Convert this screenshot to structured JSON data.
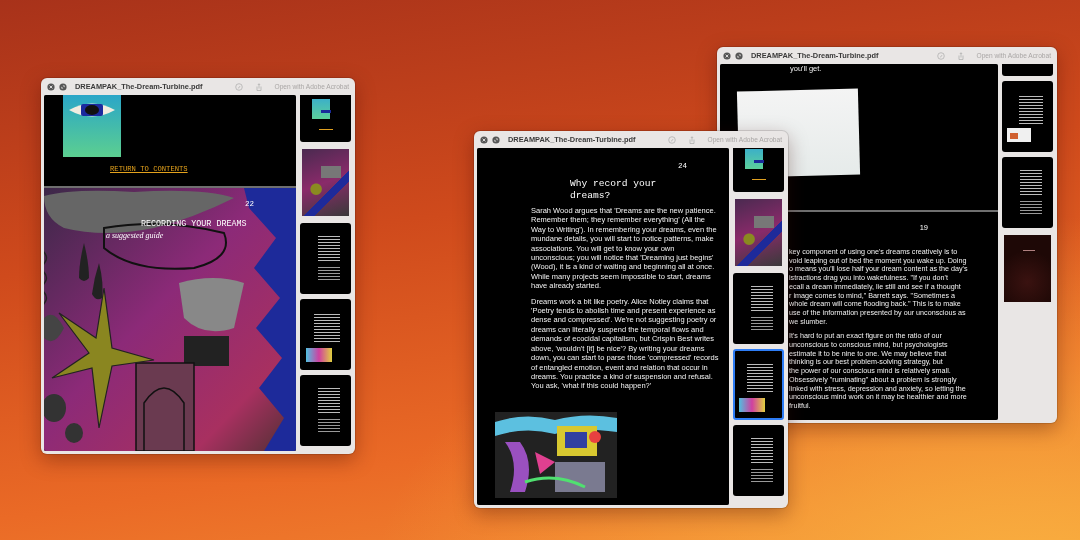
{
  "windows": [
    {
      "title": "DREAMPAK_The-Dream-Turbine.pdf",
      "open_button": "Open with Adobe Acrobat",
      "pages": [
        {
          "kind": "cover",
          "link": "RETURN TO CONTENTS"
        },
        {
          "kind": "art",
          "page_number": "22",
          "title": "RECORDING YOUR DREAMS",
          "subtitle": "a suggested guide"
        }
      ],
      "thumbnails": [
        {
          "kind": "cover",
          "selected": false
        },
        {
          "kind": "art",
          "selected": false
        },
        {
          "kind": "text",
          "selected": false
        },
        {
          "kind": "text-art",
          "selected": false
        },
        {
          "kind": "text",
          "selected": false
        }
      ]
    },
    {
      "title": "DREAMPAK_The-Dream-Turbine.pdf",
      "open_button": "Open with Adobe Acrobat",
      "pages": [
        {
          "kind": "text-art",
          "page_number": "24",
          "heading": "Why record your dreams?",
          "paragraphs": [
            "Sarah Wood argues that 'Dreams are the new patience. Remember them; they remember everything' (All the Way to Writing'). In remembering your dreams, even the mundane details, you will start to notice patterns, make associations. You will get to know your own unconscious; you will notice that 'Dreaming just begins' (Wood), it is a kind of waiting and beginning all at once. While many projects seem impossible to start, dreams have already started.",
            "Dreams work a bit like poetry. Alice Notley claims that 'Poetry tends to abolish time and present experience as dense and compressed'. We're not suggesting poetry or dreams can literally suspend the temporal flows and demands of ecocidal capitalism, but Crispin Best writes above, 'wouldn't [it] be nice'? By writing your dreams down, you can start to parse those 'compressed' records of entangled emotion, event and relation that occur in dreams. You practice a kind of suspension and refusal. You ask, 'what if this could happen?'"
          ]
        }
      ],
      "thumbnails": [
        {
          "kind": "cover",
          "selected": false
        },
        {
          "kind": "art",
          "selected": false
        },
        {
          "kind": "text",
          "selected": false
        },
        {
          "kind": "text-art",
          "selected": true
        },
        {
          "kind": "text",
          "selected": false
        }
      ]
    },
    {
      "title": "DREAMPAK_The-Dream-Turbine.pdf",
      "open_button": "Open with Adobe Acrobat",
      "pages": [
        {
          "kind": "photo",
          "text": "you'll get."
        },
        {
          "kind": "lines",
          "page_number": "19",
          "paragraphs": [
            [
              "key component of using one's dreams creatively is to",
              "void leaping out of bed the moment you wake up. Doing",
              "o means you'll lose half your dream content as the day's",
              "istractions drag you into wakefulness. \"If you don't",
              "ecall a dream immediately, lie still and see if a thought",
              "r image comes to mind,\" Barrett says. \"Sometimes a",
              "whole dream will come flooding back.\" This is to make",
              "use of the information presented by our unconscious as",
              "we slumber."
            ],
            [
              "It's hard to put an exact figure on the ratio of our",
              "unconscious to conscious mind, but psychologists",
              "estimate it to be nine to one. We may believe that",
              "thinking is our best problem-solving strategy, but",
              "the power of our conscious mind is relatively small.",
              "Obsessively \"ruminating\" about a problem is strongly",
              "linked with stress, depression and anxiety, so letting the",
              "unconscious mind work on it may be healthier and more",
              "fruitful."
            ]
          ]
        }
      ],
      "thumbnails": [
        {
          "kind": "text",
          "selected": false
        },
        {
          "kind": "text-photo",
          "selected": false
        },
        {
          "kind": "text",
          "selected": false
        },
        {
          "kind": "dark",
          "selected": false
        }
      ]
    }
  ]
}
